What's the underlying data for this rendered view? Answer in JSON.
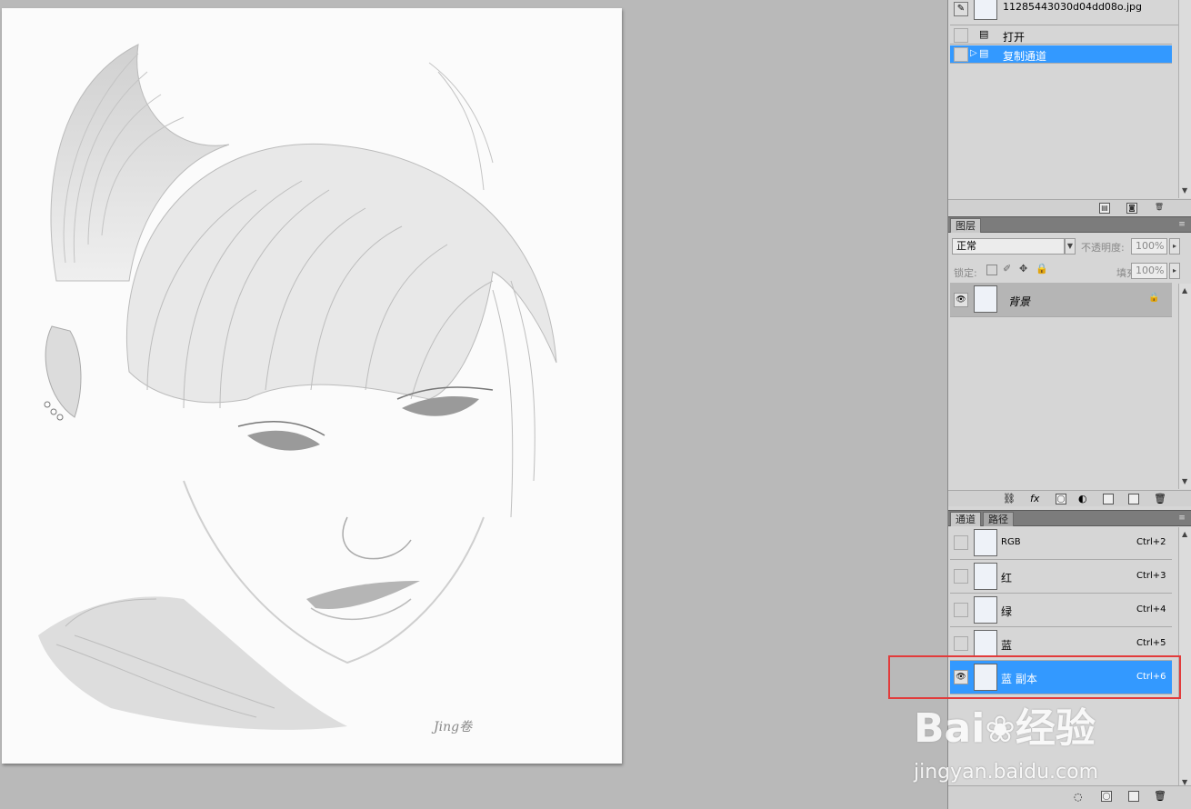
{
  "history": {
    "snapshot_name": "11285443030d04dd08o.jpg",
    "steps": [
      {
        "label": "打开",
        "selected": false
      },
      {
        "label": "复制通道",
        "selected": true
      }
    ]
  },
  "layers": {
    "tab_label": "图层",
    "blend_mode": "正常",
    "opacity_label": "不透明度:",
    "opacity_value": "100%",
    "lock_label": "锁定:",
    "fill_label": "填充:",
    "fill_value": "100%",
    "items": [
      {
        "name": "背景",
        "visible": true,
        "locked": true
      }
    ]
  },
  "channels": {
    "tabs": [
      "通道",
      "路径"
    ],
    "items": [
      {
        "name": "RGB",
        "shortcut": "Ctrl+2",
        "visible": false,
        "selected": false
      },
      {
        "name": "红",
        "shortcut": "Ctrl+3",
        "visible": false,
        "selected": false
      },
      {
        "name": "绿",
        "shortcut": "Ctrl+4",
        "visible": false,
        "selected": false
      },
      {
        "name": "蓝",
        "shortcut": "Ctrl+5",
        "visible": false,
        "selected": false
      },
      {
        "name": "蓝 副本",
        "shortcut": "Ctrl+6",
        "visible": true,
        "selected": true
      }
    ]
  },
  "canvas": {
    "signature": "Jing卷"
  },
  "watermark": {
    "brand": "Bai",
    "brand_cn": "经验",
    "url": "jingyan.baidu.com"
  },
  "colors": {
    "selection": "#3399ff",
    "highlight_box": "#e23b3b",
    "workspace": "#b9b9b9"
  }
}
